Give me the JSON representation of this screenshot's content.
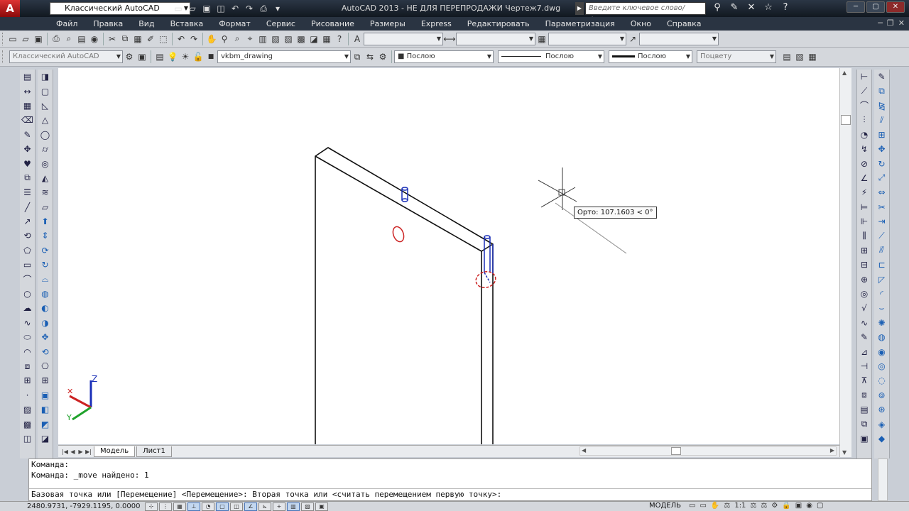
{
  "titlebar": {
    "logo_text": "A",
    "workspace": "Классический AutoCAD",
    "window_title": "AutoCAD 2013 - НЕ ДЛЯ ПЕРЕПРОДАЖИ   Чертеж7.dwg",
    "search_placeholder": "Введите ключевое слово/фразу",
    "help_label": "?"
  },
  "menu": {
    "items": [
      "Файл",
      "Правка",
      "Вид",
      "Вставка",
      "Формат",
      "Сервис",
      "Рисование",
      "Размеры",
      "Express",
      "Редактировать",
      "Параметризация",
      "Окно",
      "Справка"
    ]
  },
  "toolbar2": {
    "workspace": "Классический AutoCAD",
    "layer": "vkbm_drawing",
    "color": "Послою",
    "linetype": "Послою",
    "lineweight": "Послою",
    "plotstyle": "Поцвету"
  },
  "canvas": {
    "tooltip": "Орто: 107.1603 < 0°",
    "ucs_z": "Z",
    "ucs_y": "Y"
  },
  "layout_tabs": [
    "Модель",
    "Лист1"
  ],
  "command": {
    "line1": "Команда:",
    "line2": "Команда: _move найдено: 1",
    "prompt": "Базовая точка или [Перемещение] <Перемещение>: Вторая точка или <считать перемещением первую точку>:"
  },
  "status": {
    "coords": "2480.9731, -7929.1195, 0.0000",
    "model": "МОДЕЛЬ",
    "scale": "1:1"
  },
  "colors": {
    "accent_red": "#cc2222",
    "object_blue": "#1a2fb8",
    "title_bg": "#1a2230"
  }
}
